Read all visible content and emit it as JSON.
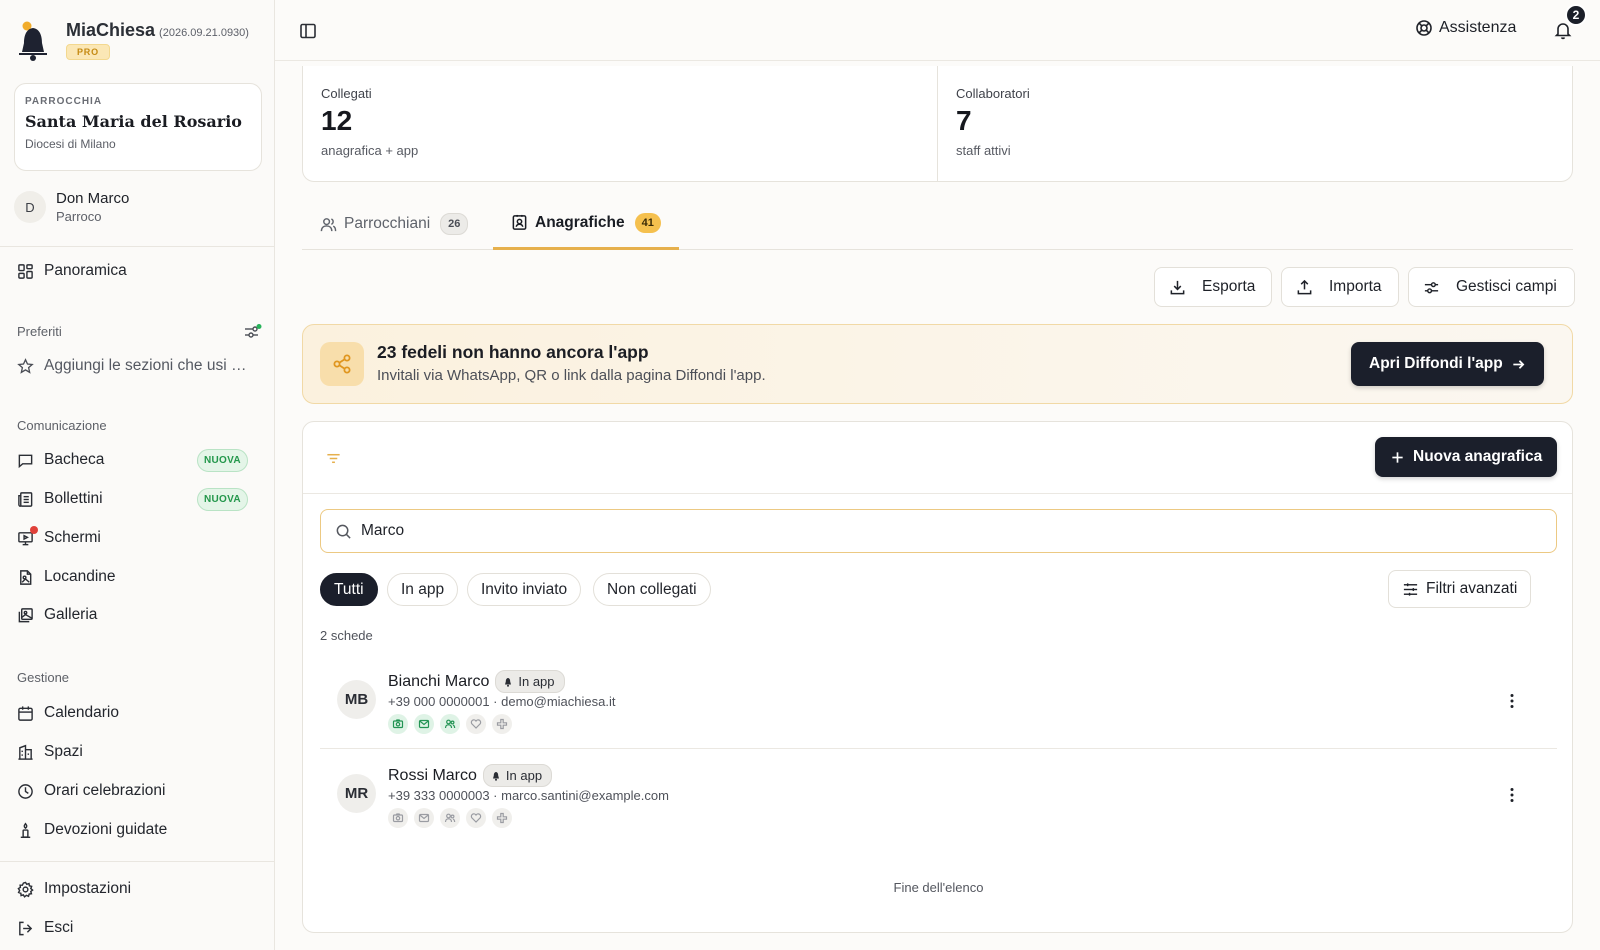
{
  "brand": {
    "name": "MiaChiesa",
    "version": "(2026.09.21.0930)",
    "tier": "PRO"
  },
  "parish": {
    "kicker": "PARROCCHIA",
    "name": "Santa Maria del Rosario",
    "diocese": "Diocesi di Milano"
  },
  "user": {
    "initial": "D",
    "name": "Don Marco",
    "role": "Parroco"
  },
  "nav": {
    "overview": "Panoramica",
    "favorites_label": "Preferiti",
    "favorites_hint": "Aggiungi le sezioni che usi di più",
    "communication_label": "Comunicazione",
    "communication": [
      {
        "label": "Bacheca",
        "badge": "NUOVA"
      },
      {
        "label": "Bollettini",
        "badge": "NUOVA"
      },
      {
        "label": "Schermi"
      },
      {
        "label": "Locandine"
      },
      {
        "label": "Galleria"
      }
    ],
    "management_label": "Gestione",
    "management": [
      {
        "label": "Calendario"
      },
      {
        "label": "Spazi"
      },
      {
        "label": "Orari celebrazioni"
      },
      {
        "label": "Devozioni guidate"
      }
    ],
    "settings": "Impostazioni",
    "logout": "Esci"
  },
  "topbar": {
    "help": "Assistenza",
    "notifications": "2"
  },
  "stats": [
    {
      "label": "Collegati",
      "value": "12",
      "sub": "anagrafica + app"
    },
    {
      "label": "Collaboratori",
      "value": "7",
      "sub": "staff attivi"
    }
  ],
  "tabs": [
    {
      "label": "Parrocchiani",
      "count": "26"
    },
    {
      "label": "Anagrafiche",
      "count": "41"
    }
  ],
  "toolbar": {
    "export": "Esporta",
    "import": "Importa",
    "fields": "Gestisci campi"
  },
  "banner": {
    "title": "23 fedeli non hanno ancora l'app",
    "subtitle": "Invitali via WhatsApp, QR o link dalla pagina Diffondi l'app.",
    "button": "Apri Diffondi l'app"
  },
  "list": {
    "new_button": "Nuova anagrafica",
    "search_value": "Marco",
    "chips": [
      "Tutti",
      "In app",
      "Invito inviato",
      "Non collegati"
    ],
    "advanced": "Filtri avanzati",
    "count": "2 schede",
    "rows": [
      {
        "initials": "MB",
        "name": "Bianchi Marco",
        "status": "In app",
        "contact": "+39 000 0000001 · demo@miachiesa.it"
      },
      {
        "initials": "MR",
        "name": "Rossi Marco",
        "status": "In app",
        "contact": "+39 333 0000003 · marco.santini@example.com"
      }
    ],
    "end": "Fine dell'elenco"
  },
  "colors": {
    "accent": "#e6b04c",
    "dark": "#1b1f2b",
    "success": "#23974b",
    "danger": "#e0413a"
  }
}
